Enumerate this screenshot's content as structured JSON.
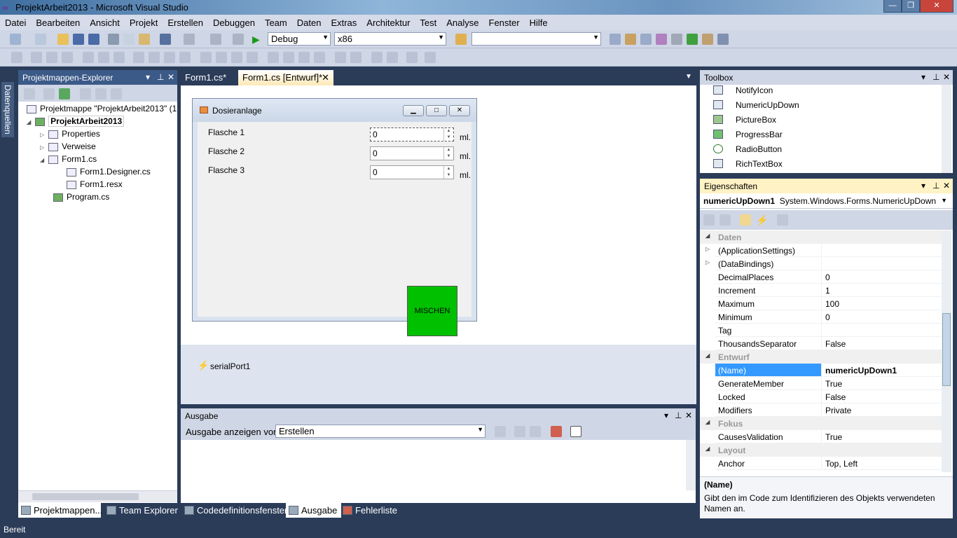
{
  "window": {
    "title": "ProjektArbeit2013 - Microsoft Visual Studio",
    "minimize": "—",
    "restore": "❐",
    "close": "✕"
  },
  "menu": [
    "Datei",
    "Bearbeiten",
    "Ansicht",
    "Projekt",
    "Erstellen",
    "Debuggen",
    "Team",
    "Daten",
    "Extras",
    "Architektur",
    "Test",
    "Analyse",
    "Fenster",
    "Hilfe"
  ],
  "toolbar": {
    "config": "Debug",
    "platform": "x86",
    "find": ""
  },
  "left_strip": {
    "label": "Datenquellen"
  },
  "solution_explorer": {
    "title": "Projektmappen-Explorer",
    "items": [
      {
        "label": "Projektmappe \"ProjektArbeit2013\" (1"
      },
      {
        "label": "ProjektArbeit2013"
      },
      {
        "label": "Properties"
      },
      {
        "label": "Verweise"
      },
      {
        "label": "Form1.cs"
      },
      {
        "label": "Form1.Designer.cs"
      },
      {
        "label": "Form1.resx"
      },
      {
        "label": "Program.cs"
      }
    ]
  },
  "doc_tabs": [
    {
      "label": "Form1.cs*"
    },
    {
      "label": "Form1.cs [Entwurf]*"
    }
  ],
  "form": {
    "title": "Dosieranlage",
    "rows": [
      {
        "label": "Flasche 1",
        "value": "0",
        "unit": "ml."
      },
      {
        "label": "Flasche 2",
        "value": "0",
        "unit": "ml."
      },
      {
        "label": "Flasche 3",
        "value": "0",
        "unit": "ml."
      }
    ],
    "button": "MISCHEN",
    "button_color": "#00c000"
  },
  "tray": {
    "component": "serialPort1"
  },
  "output": {
    "title": "Ausgabe",
    "show_label": "Ausgabe anzeigen von:",
    "source": "Erstellen"
  },
  "toolbox": {
    "title": "Toolbox",
    "items": [
      "NotifyIcon",
      "NumericUpDown",
      "PictureBox",
      "ProgressBar",
      "RadioButton",
      "RichTextBox"
    ]
  },
  "properties": {
    "title": "Eigenschaften",
    "object_name": "numericUpDown1",
    "object_type": "System.Windows.Forms.NumericUpDown",
    "rows": [
      {
        "name": "Daten",
        "value": "",
        "cat": true
      },
      {
        "name": "(ApplicationSettings)",
        "value": "",
        "expandable": true
      },
      {
        "name": "(DataBindings)",
        "value": "",
        "expandable": true
      },
      {
        "name": "DecimalPlaces",
        "value": "0"
      },
      {
        "name": "Increment",
        "value": "1"
      },
      {
        "name": "Maximum",
        "value": "100"
      },
      {
        "name": "Minimum",
        "value": "0"
      },
      {
        "name": "Tag",
        "value": ""
      },
      {
        "name": "ThousandsSeparator",
        "value": "False"
      },
      {
        "name": "Entwurf",
        "value": "",
        "cat": true
      },
      {
        "name": "(Name)",
        "value": "numericUpDown1",
        "selected": true
      },
      {
        "name": "GenerateMember",
        "value": "True"
      },
      {
        "name": "Locked",
        "value": "False"
      },
      {
        "name": "Modifiers",
        "value": "Private"
      },
      {
        "name": "Fokus",
        "value": "",
        "cat": true
      },
      {
        "name": "CausesValidation",
        "value": "True"
      },
      {
        "name": "Layout",
        "value": "",
        "cat": true
      },
      {
        "name": "Anchor",
        "value": "Top, Left"
      }
    ],
    "desc_title": "(Name)",
    "desc_text": "Gibt den im Code zum Identifizieren des Objekts verwendeten Namen an."
  },
  "bottom_tabs": [
    "Projektmappen...",
    "Team Explorer",
    "Codedefinitionsfenster",
    "Ausgabe",
    "Fehlerliste"
  ],
  "status": "Bereit"
}
